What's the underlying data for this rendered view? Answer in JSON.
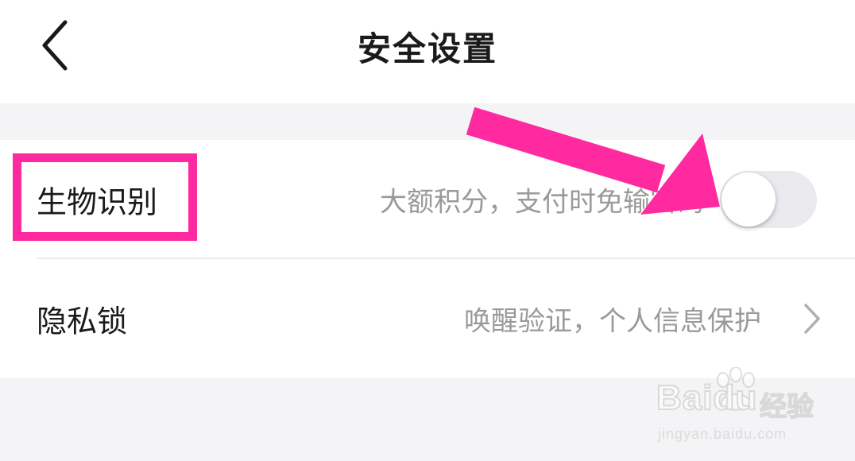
{
  "header": {
    "title": "安全设置",
    "back_icon": "chevron-left-icon"
  },
  "settings": [
    {
      "label": "生物识别",
      "description": "大额积分，支付时免输密码",
      "control": "toggle",
      "toggle_on": false
    },
    {
      "label": "隐私锁",
      "description": "唤醒验证，个人信息保护",
      "control": "chevron",
      "chevron_icon": "chevron-right-icon"
    }
  ],
  "annotations": {
    "color": "#ff2aa0",
    "highlight_target": "生物识别",
    "arrow_target": "toggle"
  },
  "watermark": {
    "brand": "Baidu",
    "product": "经验",
    "url": "jingyan.baidu.com"
  },
  "colors": {
    "background": "#ffffff",
    "section_gap": "#f4f4f6",
    "primary_text": "#1a1a1a",
    "secondary_text": "#9a9a9a",
    "toggle_track_off": "#e9e9ee",
    "annotation": "#ff2aa0"
  }
}
